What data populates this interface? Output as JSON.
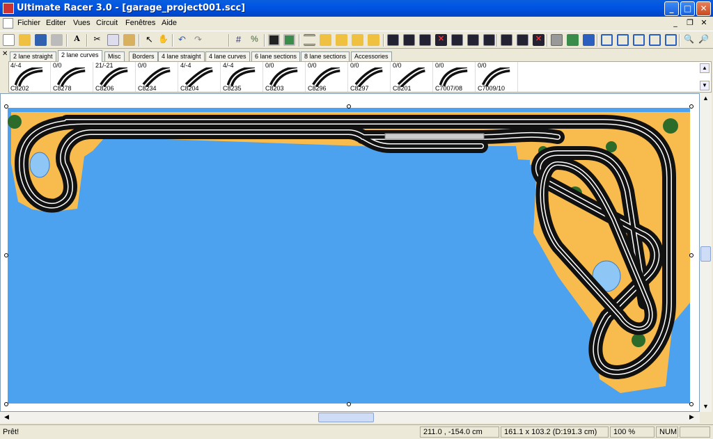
{
  "window": {
    "title": "Ultimate Racer 3.0 - [garage_project001.scc]"
  },
  "menu": [
    "Fichier",
    "Editer",
    "Vues",
    "Circuit",
    "Fenêtres",
    "Aide"
  ],
  "tabs": [
    "2 lane straight",
    "2 lane curves",
    "Misc",
    "Borders",
    "4 lane straight",
    "4 lane curves",
    "6 lane sections",
    "8 lane sections",
    "Accessories"
  ],
  "active_tab": "2 lane curves",
  "palette": [
    {
      "ratio": "4/-4",
      "code": "C8202"
    },
    {
      "ratio": "0/0",
      "code": "C8278"
    },
    {
      "ratio": "21/-21",
      "code": "C8206"
    },
    {
      "ratio": "0/0",
      "code": "C8234"
    },
    {
      "ratio": "4/-4",
      "code": "C8204"
    },
    {
      "ratio": "4/-4",
      "code": "C8235"
    },
    {
      "ratio": "0/0",
      "code": "C8203"
    },
    {
      "ratio": "0/0",
      "code": "C8296"
    },
    {
      "ratio": "0/0",
      "code": "C8297"
    },
    {
      "ratio": "0/0",
      "code": "C8201"
    },
    {
      "ratio": "0/0",
      "code": "C7007/08"
    },
    {
      "ratio": "0/0",
      "code": "C7009/10"
    }
  ],
  "status": {
    "text": "Prêt!",
    "coords": "211.0 , -154.0 cm",
    "dimensions": "161.1 x 103.2  (D:191.3 cm)",
    "zoom": "100 %",
    "num": "NUM"
  },
  "colors": {
    "water": "#4da2ef",
    "sand": "#f8bb4d",
    "track": "#111111",
    "lane": "#ffffff"
  }
}
